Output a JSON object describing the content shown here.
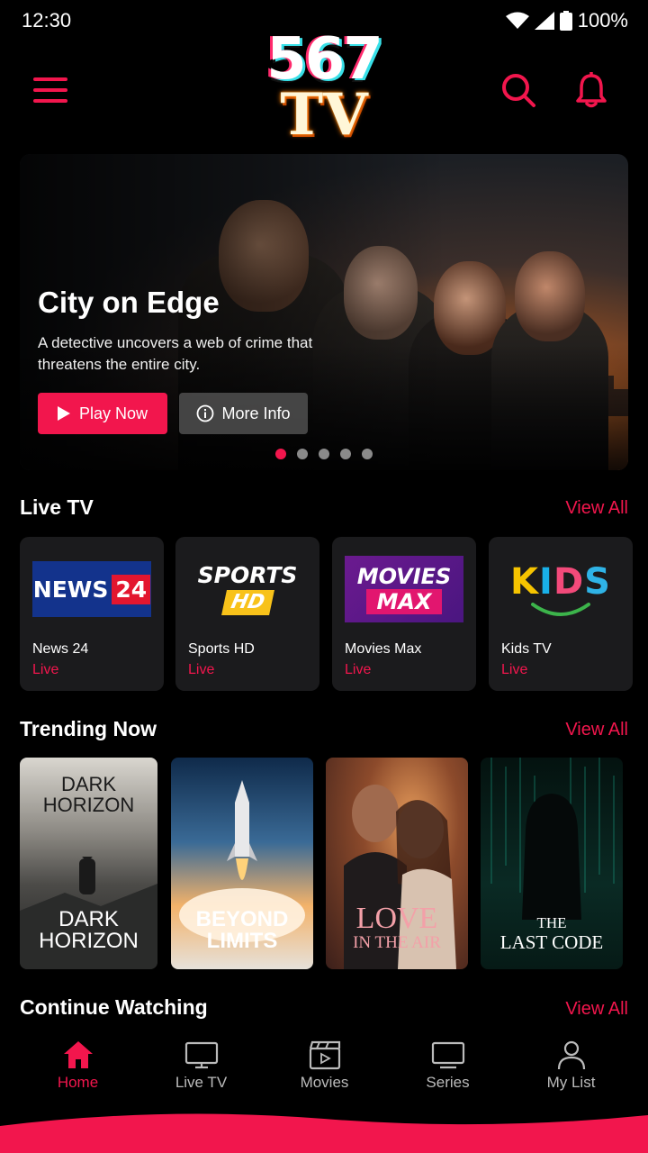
{
  "status": {
    "time": "12:30",
    "battery": "100%"
  },
  "brand": {
    "line1": "567",
    "line2": "TV",
    "accent": "#f2164d"
  },
  "hero": {
    "title": "City on Edge",
    "description": "A detective uncovers a web of crime that threatens the entire city.",
    "play_label": "Play Now",
    "info_label": "More Info",
    "slides": 5,
    "active_slide": 1
  },
  "live_tv": {
    "title": "Live TV",
    "view_all": "View All",
    "channels": [
      {
        "name": "News 24",
        "status": "Live",
        "logo_a": "NEWS",
        "logo_b": "24"
      },
      {
        "name": "Sports HD",
        "status": "Live",
        "logo_a": "SPORTS",
        "logo_b": "HD"
      },
      {
        "name": "Movies Max",
        "status": "Live",
        "logo_a": "MOVIES",
        "logo_b": "MAX"
      },
      {
        "name": "Kids TV",
        "status": "Live",
        "logo_a": "KIDS"
      }
    ]
  },
  "trending": {
    "title": "Trending Now",
    "view_all": "View All",
    "items": [
      {
        "top": "DARK HORIZON",
        "bottom": "DARK HORIZON"
      },
      {
        "bottom": "BEYOND LIMITS"
      },
      {
        "line1": "LOVE",
        "line2": "IN THE AIR"
      },
      {
        "line1": "THE",
        "line2": "LAST CODE"
      }
    ]
  },
  "continue": {
    "title": "Continue Watching",
    "view_all": "View All"
  },
  "nav": [
    {
      "label": "Home",
      "icon": "home-icon",
      "active": true
    },
    {
      "label": "Live TV",
      "icon": "tv-icon"
    },
    {
      "label": "Movies",
      "icon": "clapperboard-icon"
    },
    {
      "label": "Series",
      "icon": "monitor-icon"
    },
    {
      "label": "My List",
      "icon": "user-icon"
    }
  ]
}
